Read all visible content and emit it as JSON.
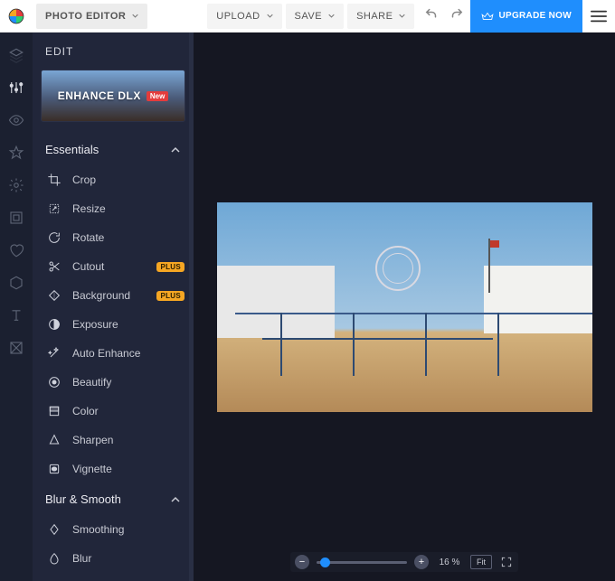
{
  "topbar": {
    "mode_label": "PHOTO EDITOR",
    "upload_label": "UPLOAD",
    "save_label": "SAVE",
    "share_label": "SHARE",
    "upgrade_label": "UPGRADE NOW"
  },
  "panel": {
    "title": "EDIT",
    "promo": {
      "label": "ENHANCE DLX",
      "badge": "New"
    },
    "sections": {
      "essentials": {
        "label": "Essentials",
        "items": [
          {
            "label": "Crop"
          },
          {
            "label": "Resize"
          },
          {
            "label": "Rotate"
          },
          {
            "label": "Cutout",
            "plus": "PLUS"
          },
          {
            "label": "Background",
            "plus": "PLUS"
          },
          {
            "label": "Exposure"
          },
          {
            "label": "Auto Enhance"
          },
          {
            "label": "Beautify"
          },
          {
            "label": "Color"
          },
          {
            "label": "Sharpen"
          },
          {
            "label": "Vignette"
          }
        ]
      },
      "blur": {
        "label": "Blur & Smooth",
        "items": [
          {
            "label": "Smoothing"
          },
          {
            "label": "Blur"
          }
        ]
      }
    }
  },
  "iconstrip": [
    "layers-icon",
    "sliders-icon",
    "eye-icon",
    "star-icon",
    "gear-icon",
    "frame-icon",
    "heart-icon",
    "hexagon-icon",
    "text-icon",
    "texture-icon"
  ],
  "zoom": {
    "percent": "16 %",
    "fit_label": "Fit"
  }
}
